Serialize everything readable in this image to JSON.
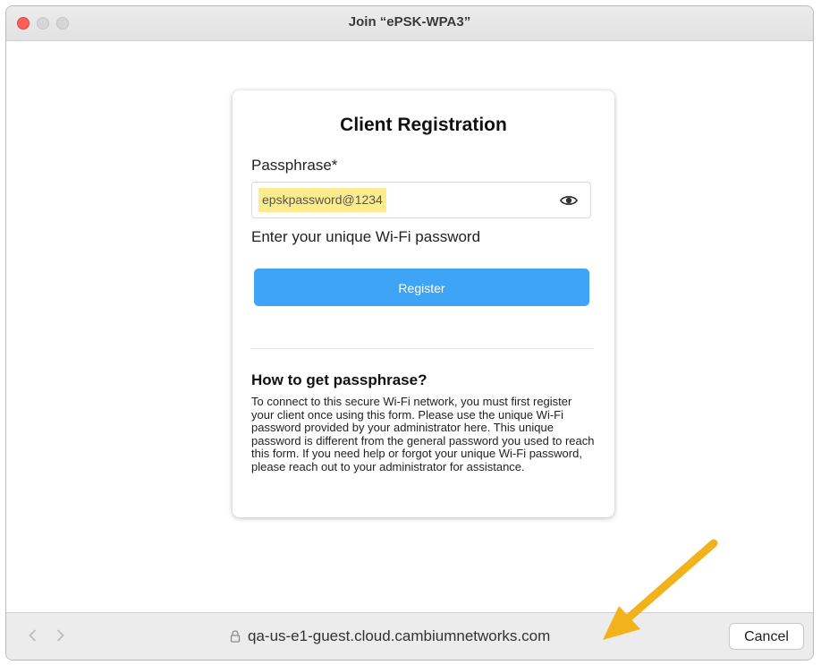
{
  "window": {
    "title": "Join “ePSK-WPA3”"
  },
  "card": {
    "title": "Client Registration",
    "passphrase_label": "Passphrase*",
    "passphrase_value": "epskpassword@1234",
    "helper_text": "Enter your unique Wi-Fi password",
    "register_label": "Register",
    "help_title": "How to get passphrase?",
    "help_body": "To connect to this secure Wi-Fi network, you must first register your client once using this form. Please use the unique Wi-Fi password provided by your administrator here. This unique password is different from the general password you used to reach this form. If you need help or forgot your unique Wi-Fi password, please reach out to your administrator for assistance."
  },
  "bottombar": {
    "url": "qa-us-e1-guest.cloud.cambiumnetworks.com",
    "cancel_label": "Cancel"
  },
  "icons": {
    "eye": "eye-icon",
    "lock": "lock-icon",
    "back": "chevron-left-icon",
    "forward": "chevron-right-icon"
  },
  "colors": {
    "register_button": "#3ea4f5",
    "highlight": "#fcec8e",
    "annotation_arrow": "#f2b21b",
    "close_button": "#fe5f57"
  }
}
